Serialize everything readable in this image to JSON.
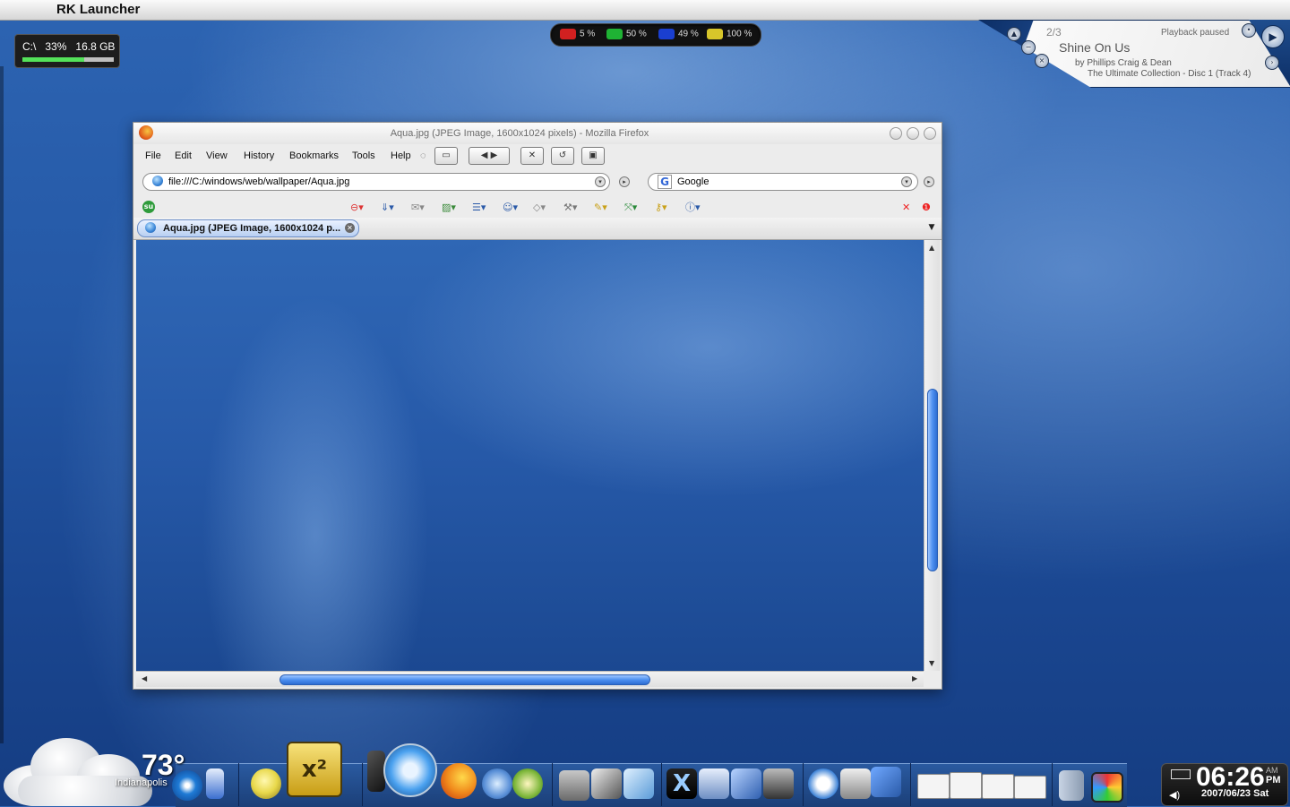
{
  "menubar": {
    "app_name": "RK Launcher",
    "apple_icon": "apple-icon"
  },
  "drive_widget": {
    "label": "C:\\",
    "percent_text": "33%",
    "free_text": "16.8 GB",
    "fill_fraction": 0.68,
    "fill_color": "#54e25a"
  },
  "system_meter": {
    "items": [
      {
        "icon": "cpu-icon",
        "value": "5 %",
        "color": "#d22020"
      },
      {
        "icon": "memory-icon",
        "value": "50 %",
        "color": "#1fb234"
      },
      {
        "icon": "network-icon",
        "value": "49 %",
        "color": "#1a3fd0"
      },
      {
        "icon": "battery-icon",
        "value": "100 %",
        "color": "#d8c62a"
      }
    ]
  },
  "player": {
    "track_number": "2/3",
    "state": "Playback paused",
    "song": "Shine On Us",
    "artist": "by Phillips Craig & Dean",
    "album": "The Ultimate Collection - Disc 1 (Track 4)"
  },
  "browser": {
    "title": "Aqua.jpg (JPEG Image, 1600x1024 pixels) - Mozilla Firefox",
    "menus": [
      "File",
      "Edit",
      "View",
      "History",
      "Bookmarks",
      "Tools",
      "Help"
    ],
    "url": "file:///C:/windows/web/wallpaper/Aqua.jpg",
    "search_engine": "Google",
    "tab_label": "Aqua.jpg (JPEG Image, 1600x1024 p...",
    "toolbar_icons": [
      "stop-icon",
      "download-icon",
      "mail-icon",
      "image-icon",
      "forms-icon",
      "user-icon",
      "cube-icon",
      "tools-icon",
      "pencil-icon",
      "resize-icon",
      "key-icon",
      "info-icon"
    ]
  },
  "weather": {
    "temperature": "73°",
    "city": "Indianapolis"
  },
  "clock": {
    "time": "06:26",
    "am": "AM",
    "pm": "PM",
    "date": "2007/06/23 Sat"
  }
}
